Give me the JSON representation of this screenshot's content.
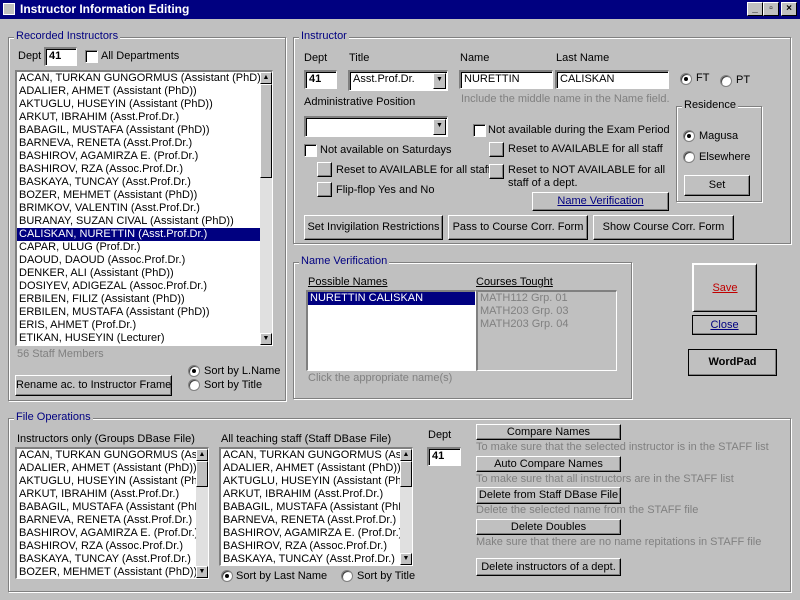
{
  "window": {
    "title": "Instructor Information Editing",
    "controls": [
      "_",
      "▫",
      "×"
    ]
  },
  "recorded": {
    "title": "Recorded Instructors",
    "dept_label": "Dept",
    "dept_value": "41",
    "all_departments_label": "All Departments",
    "items": [
      "ACAN, TURKAN GUNGORMUS (Assistant (PhD))",
      "ADALIER, AHMET (Assistant (PhD))",
      "AKTUGLU, HUSEYIN (Assistant (PhD))",
      "ARKUT, IBRAHIM (Asst.Prof.Dr.)",
      "BABAGIL, MUSTAFA (Assistant (PhD))",
      "BARNEVA, RENETA (Asst.Prof.Dr.)",
      "BASHIROV, AGAMIRZA E. (Prof.Dr.)",
      "BASHIROV, RZA (Assoc.Prof.Dr.)",
      "BASKAYA, TUNCAY (Asst.Prof.Dr.)",
      "BOZER, MEHMET (Assistant (PhD))",
      "BRIMKOV, VALENTIN (Asst.Prof.Dr.)",
      "BURANAY, SUZAN CIVAL (Assistant (PhD))",
      "CALISKAN, NURETTIN (Asst.Prof.Dr.)",
      "CAPAR, ULUG (Prof.Dr.)",
      "DAOUD, DAOUD (Assoc.Prof.Dr.)",
      "DENKER, ALI (Assistant (PhD))",
      "DOSIYEV, ADIGEZAL (Assoc.Prof.Dr.)",
      "ERBILEN, FILIZ (Assistant (PhD))",
      "ERBILEN, MUSTAFA (Assistant (PhD))",
      "ERIS, AHMET (Prof.Dr.)",
      "ETIKAN, HUSEYIN (Lecturer)"
    ],
    "selected_index": 12,
    "staff_count": "56 Staff Members",
    "rename_button": "Rename ac. to Instructor Frame",
    "sort_lname": "Sort by L.Name",
    "sort_title": "Sort by Title"
  },
  "instructor": {
    "title": "Instructor",
    "dept_label": "Dept",
    "dept_value": "41",
    "title_label": "Title",
    "title_value": "Asst.Prof.Dr.",
    "name_label": "Name",
    "name_value": "NURETTIN",
    "lastname_label": "Last Name",
    "lastname_value": "CALISKAN",
    "ft_label": "FT",
    "pt_label": "PT",
    "middle_name_hint": "Include the middle name in the Name field.",
    "admin_label": "Administrative Position",
    "admin_value": "",
    "not_avail_sat": "Not available on Saturdays",
    "reset_avail_all_left": "Reset to AVAILABLE for all staff",
    "flip_flop": "Flip-flop Yes and No",
    "not_avail_exam": "Not available during the Exam Period",
    "reset_avail_all_right": "Reset to AVAILABLE for all staff",
    "reset_not_avail_line1": "Reset to NOT AVAILABLE for all",
    "reset_not_avail_line2": "staff of a dept.",
    "name_verification_button": "Name Verification",
    "set_invig_button": "Set Invigilation Restrictions",
    "pass_course_button": "Pass to Course Corr. Form",
    "show_course_button": "Show Course Corr. Form"
  },
  "residence": {
    "title": "Residence",
    "magusa": "Magusa",
    "elsewhere": "Elsewhere",
    "set_button": "Set"
  },
  "verification": {
    "title": "Name Verification",
    "possible_header": "Possible Names",
    "courses_header": "Courses Tought",
    "possible_names": [
      "NURETTIN CALISKAN"
    ],
    "courses": [
      "MATH112  Grp. 01",
      "MATH203  Grp. 03",
      "MATH203  Grp. 04"
    ],
    "hint": "Click the appropriate name(s)"
  },
  "actions": {
    "save": "Save",
    "close": "Close",
    "wordpad": "WordPad"
  },
  "file_ops": {
    "title": "File Operations",
    "instructors_only_label": "Instructors only (Groups DBase File)",
    "all_staff_label": "All teaching staff (Staff DBase File)",
    "instructors_only_items": [
      "ACAN, TURKAN GUNGORMUS (Assistant (PhD))",
      "ADALIER, AHMET (Assistant (PhD))",
      "AKTUGLU, HUSEYIN (Assistant (PhD))",
      "ARKUT, IBRAHIM (Asst.Prof.Dr.)",
      "BABAGIL, MUSTAFA (Assistant (PhD))",
      "BARNEVA, RENETA (Asst.Prof.Dr.)",
      "BASHIROV, AGAMIRZA E. (Prof.Dr.)",
      "BASHIROV, RZA (Assoc.Prof.Dr.)",
      "BASKAYA, TUNCAY (Asst.Prof.Dr.)",
      "BOZER, MEHMET (Assistant (PhD))"
    ],
    "all_staff_items": [
      "ACAN, TURKAN GUNGORMUS (Assistant (PhD))",
      "ADALIER, AHMET (Assistant (PhD))",
      "AKTUGLU, HUSEYIN (Assistant (PhD))",
      "ARKUT, IBRAHIM (Asst.Prof.Dr.)",
      "BABAGIL, MUSTAFA (Assistant (PhD))",
      "BARNEVA, RENETA (Asst.Prof.Dr.)",
      "BASHIROV, AGAMIRZA E. (Prof.Dr.)",
      "BASHIROV, RZA (Assoc.Prof.Dr.)",
      "BASKAYA, TUNCAY (Asst.Prof.Dr.)"
    ],
    "sort_last_name": "Sort by Last Name",
    "sort_title": "Sort by Title",
    "dept_label": "Dept",
    "dept_value": "41",
    "compare_button": "Compare Names",
    "compare_hint": "To make sure that the selected instructor is in the STAFF list",
    "auto_compare_button": "Auto Compare Names",
    "auto_compare_hint": "To make sure that all instructors are in the STAFF list",
    "delete_staff_button": "Delete from Staff DBase File",
    "delete_staff_hint": "Delete the selected name from the STAFF file",
    "delete_doubles_button": "Delete Doubles",
    "delete_doubles_hint": "Make sure that there are no name repitations in STAFF file",
    "delete_dept_button": "Delete instructors of a dept."
  }
}
